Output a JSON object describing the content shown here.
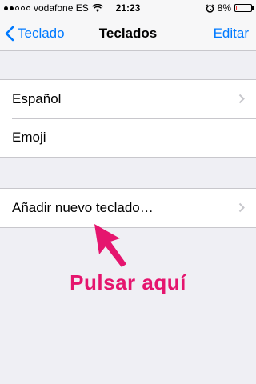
{
  "status": {
    "carrier": "vodafone ES",
    "time": "21:23",
    "battery_percent": "8%",
    "battery_level": 0.08,
    "signal_bars": 2
  },
  "nav": {
    "back_label": "Teclado",
    "title": "Teclados",
    "edit_label": "Editar"
  },
  "keyboards": [
    {
      "label": "Español"
    },
    {
      "label": "Emoji"
    }
  ],
  "add_keyboard_label": "Añadir nuevo teclado…",
  "annotation": {
    "text": "Pulsar aquí",
    "color": "#e5156e"
  },
  "colors": {
    "accent": "#007aff",
    "background": "#efeff4"
  }
}
